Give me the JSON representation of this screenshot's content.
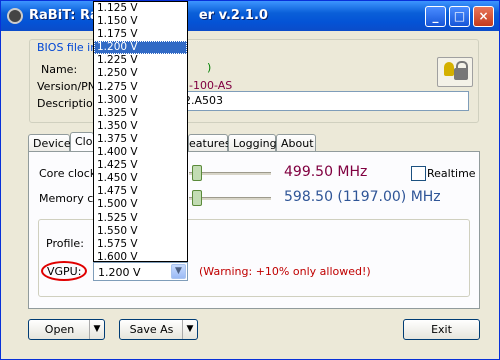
{
  "window": {
    "title": "RaBiT: Ra",
    "title_tail": "er v.2.1.0",
    "minimize": "_",
    "maximize": "□",
    "close": "×"
  },
  "bios_group": {
    "label": "BIOS file inf",
    "name_label": "Name:",
    "name_value_tail": ")",
    "version_label": "Version/PN:",
    "version_value_tail": "-100-AS",
    "description_label": "Description",
    "description_value": "2.A503",
    "lock_icon": "lock-icon"
  },
  "tabs": [
    {
      "label": "Device"
    },
    {
      "label": "Clo"
    },
    {
      "label": "eatures"
    },
    {
      "label": "Logging"
    },
    {
      "label": "About"
    }
  ],
  "clocks": {
    "core_label": "Core clock:",
    "core_value": "499.50 MHz",
    "memory_label": "Memory clo",
    "memory_value": "598.50 (1197.00) MHz",
    "realtime_label": "Realtime",
    "realtime_checked": false
  },
  "voltage": {
    "profile_label": "Profile:",
    "vgpu_label": "VGPU:",
    "vgpu_selected": "1.200 V",
    "warning": "(Warning: +10% only allowed!)",
    "options": [
      "1.125 V",
      "1.150 V",
      "1.175 V",
      "1.200 V",
      "1.225 V",
      "1.250 V",
      "1.275 V",
      "1.300 V",
      "1.325 V",
      "1.350 V",
      "1.375 V",
      "1.400 V",
      "1.425 V",
      "1.450 V",
      "1.475 V",
      "1.500 V",
      "1.525 V",
      "1.550 V",
      "1.575 V",
      "1.600 V"
    ],
    "selected_index": 3
  },
  "buttons": {
    "open": "Open",
    "save_as": "Save As",
    "exit": "Exit",
    "split_arrow": "▼"
  },
  "colors": {
    "highlight": "#316ac5",
    "warning": "#c00000",
    "vgpu_circle": "#e00000"
  }
}
